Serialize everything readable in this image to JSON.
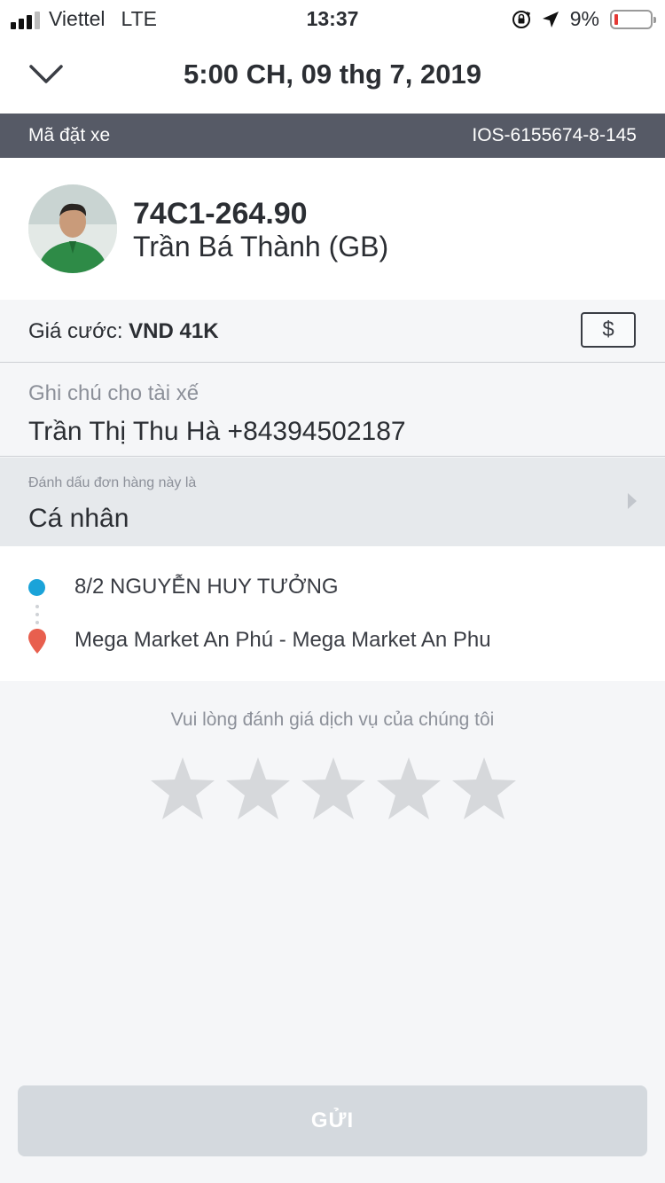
{
  "status_bar": {
    "carrier": "Viettel",
    "network": "LTE",
    "time": "13:37",
    "battery_percent": "9%",
    "battery_level": 0.09,
    "signal_bars_active": 3,
    "icons": [
      "signal-bars-icon",
      "rotation-lock-icon",
      "location-arrow-icon",
      "battery-low-icon"
    ]
  },
  "header": {
    "title": "5:00 CH, 09 thg 7, 2019",
    "back_icon": "chevron-down-icon"
  },
  "booking": {
    "code_label": "Mã đặt xe",
    "code_value": "IOS-6155674-8-145"
  },
  "driver": {
    "plate": "74C1-264.90",
    "name": "Trần Bá Thành (GB)"
  },
  "fare": {
    "label": "Giá cước:",
    "value": "VND 41K",
    "payment_symbol": "$"
  },
  "note": {
    "label": "Ghi chú cho tài xế",
    "value": "Trần Thị Thu Hà +84394502187"
  },
  "tag": {
    "label": "Đánh dấu đơn hàng này là",
    "value": "Cá nhân"
  },
  "route": {
    "pickup": "8/2 NGUYỄN HUY TƯỞNG",
    "dropoff": "Mega Market An Phú - Mega Market An Phu"
  },
  "rating": {
    "prompt": "Vui lòng đánh giá dịch vụ của chúng tôi",
    "max_stars": 5,
    "selected": 0
  },
  "submit": {
    "label": "GỬI"
  },
  "colors": {
    "pickup": "#1aa3d9",
    "dropoff": "#e85f4e",
    "code_bar": "#565a66",
    "star_inactive": "#d6d8db",
    "submit_disabled": "#d4d9de"
  }
}
